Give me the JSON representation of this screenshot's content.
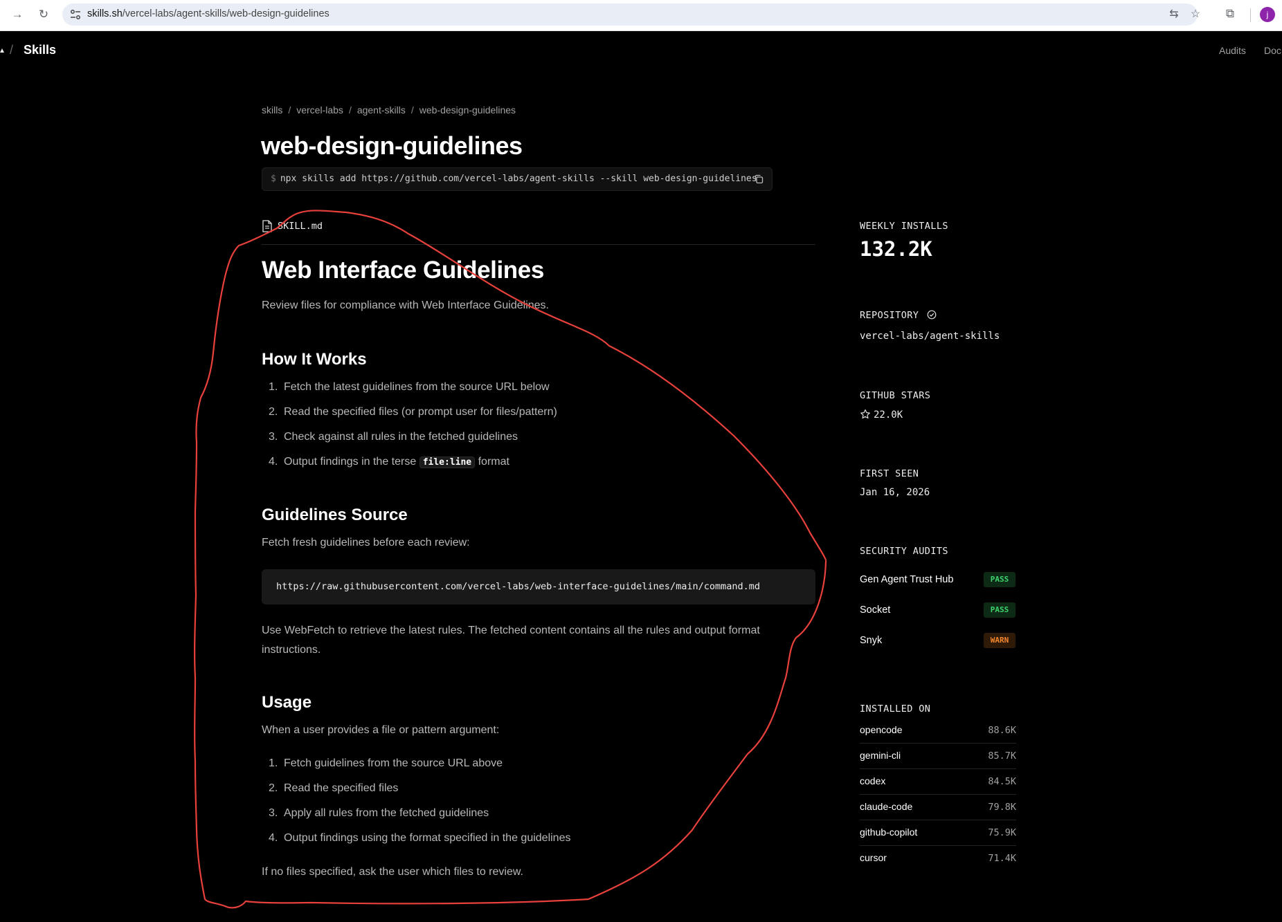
{
  "browser": {
    "url_host": "skills.sh",
    "url_path": "/vercel-labs/agent-skills/web-design-guidelines",
    "avatar_letter": "j"
  },
  "header": {
    "title": "Skills",
    "links": [
      "Audits",
      "Doc"
    ]
  },
  "breadcrumb": [
    "skills",
    "vercel-labs",
    "agent-skills",
    "web-design-guidelines"
  ],
  "page_title": "web-design-guidelines",
  "install_command": {
    "prompt": "$",
    "text": "npx skills add https://github.com/vercel-labs/agent-skills --skill web-design-guidelines"
  },
  "file_name": "SKILL.md",
  "content": {
    "h1": "Web Interface Guidelines",
    "intro": "Review files for compliance with Web Interface Guidelines.",
    "how_it_works": {
      "heading": "How It Works",
      "items": [
        "Fetch the latest guidelines from the source URL below",
        "Read the specified files (or prompt user for files/pattern)",
        "Check against all rules in the fetched guidelines"
      ],
      "item4_before": "Output findings in the terse",
      "item4_code": "file:line",
      "item4_after": "format"
    },
    "source": {
      "heading": "Guidelines Source",
      "text": "Fetch fresh guidelines before each review:",
      "url": "https://raw.githubusercontent.com/vercel-labs/web-interface-guidelines/main/command.md",
      "note_line1": "Use WebFetch to retrieve the latest rules. The fetched content contains all the rules and output format",
      "note_line2": "instructions."
    },
    "usage": {
      "heading": "Usage",
      "text": "When a user provides a file or pattern argument:",
      "items": [
        "Fetch guidelines from the source URL above",
        "Read the specified files",
        "Apply all rules from the fetched guidelines",
        "Output findings using the format specified in the guidelines"
      ],
      "footer": "If no files specified, ask the user which files to review."
    }
  },
  "sidebar": {
    "weekly_installs_label": "WEEKLY INSTALLS",
    "weekly_installs": "132.2K",
    "repository_label": "REPOSITORY",
    "repository": "vercel-labs/agent-skills",
    "github_stars_label": "GITHUB STARS",
    "github_stars": "22.0K",
    "first_seen_label": "FIRST SEEN",
    "first_seen": "Jan 16, 2026",
    "security_label": "SECURITY AUDITS",
    "audits": [
      {
        "name": "Gen Agent Trust Hub",
        "status": "PASS"
      },
      {
        "name": "Socket",
        "status": "PASS"
      },
      {
        "name": "Snyk",
        "status": "WARN"
      }
    ],
    "installed_on_label": "INSTALLED ON",
    "installed_on": [
      {
        "name": "opencode",
        "count": "88.6K"
      },
      {
        "name": "gemini-cli",
        "count": "85.7K"
      },
      {
        "name": "codex",
        "count": "84.5K"
      },
      {
        "name": "claude-code",
        "count": "79.8K"
      },
      {
        "name": "github-copilot",
        "count": "75.9K"
      },
      {
        "name": "cursor",
        "count": "71.4K"
      }
    ]
  },
  "colors": {
    "background": "#000000",
    "pass": "#3ed36c",
    "warn": "#f5862e",
    "annotation": "#e8413c"
  },
  "icons": [
    "forward-icon",
    "reload-icon",
    "site-settings-icon",
    "translate-icon",
    "bookmark-star-icon",
    "extensions-icon",
    "document-icon",
    "copy-icon",
    "verified-icon",
    "star-icon"
  ]
}
